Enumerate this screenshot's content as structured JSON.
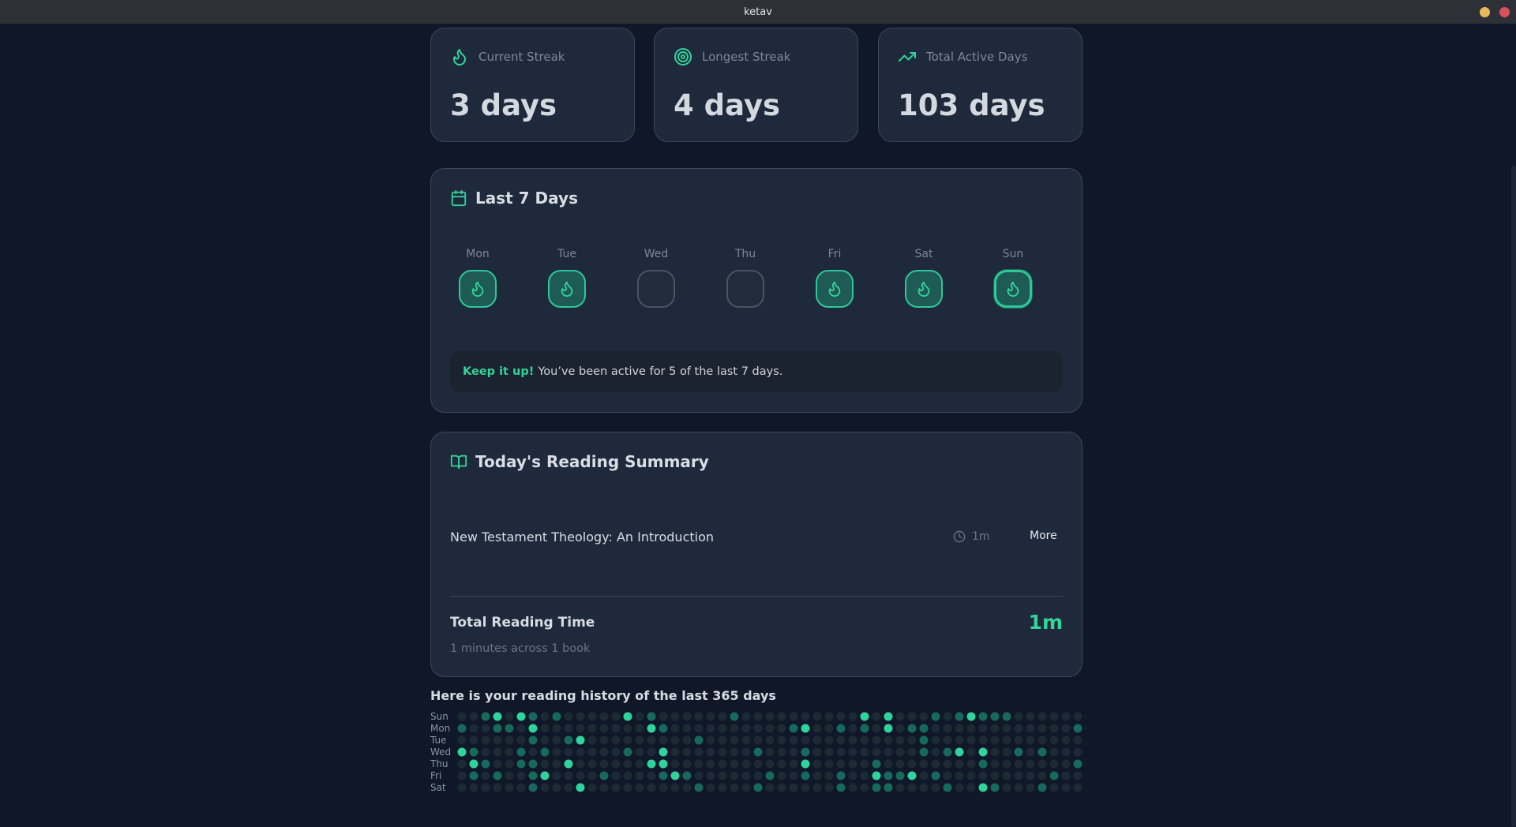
{
  "window": {
    "title": "ketav"
  },
  "stats": [
    {
      "icon": "flame-icon",
      "label": "Current Streak",
      "value": "3 days"
    },
    {
      "icon": "target-icon",
      "label": "Longest Streak",
      "value": "4 days"
    },
    {
      "icon": "trending-up-icon",
      "label": "Total Active Days",
      "value": "103 days"
    }
  ],
  "last7": {
    "title": "Last 7 Days",
    "days": [
      {
        "name": "Mon",
        "active": true
      },
      {
        "name": "Tue",
        "active": true
      },
      {
        "name": "Wed",
        "active": false
      },
      {
        "name": "Thu",
        "active": false
      },
      {
        "name": "Fri",
        "active": true
      },
      {
        "name": "Sat",
        "active": true
      },
      {
        "name": "Sun",
        "active": true,
        "today": true
      }
    ],
    "message_strong": "Keep it up!",
    "message_text": "You’ve been active for 5 of the last 7 days."
  },
  "summary": {
    "title": "Today's Reading Summary",
    "books": [
      {
        "title": "New Testament Theology: An Introduction",
        "time": "1m",
        "more_label": "More"
      }
    ],
    "total_label": "Total Reading Time",
    "total_value": "1m",
    "total_sub": "1 minutes across 1 book"
  },
  "history": {
    "title": "Here is your reading history of the last 365 days",
    "row_labels": [
      "Sun",
      "Mon",
      "Tue",
      "Wed",
      "Thu",
      "Fri",
      "Sat"
    ],
    "levels": [
      "0012021010000020100000010000000000202000101211100000011000001112",
      "1001102000000000210000000000120010102011000000000000110010010001",
      "0000001001200000000010000000000000000001000000000000001020001100",
      "2100010100000010020000000100010000000001012020010100000001100210",
      "0210011002000000220000000000020000010000000010000000102010000201",
      "0101001200001000012100000010010010021120100000000010000100102001",
      "0000001000200000000010000100000010011000010021000100002000111111"
    ],
    "colors": {
      "0": "#1c2a34",
      "1": "#17695c",
      "2": "#2ed49b"
    }
  },
  "colors": {
    "accent": "#34d399",
    "background": "#0f1729",
    "card": "#1e293b"
  }
}
